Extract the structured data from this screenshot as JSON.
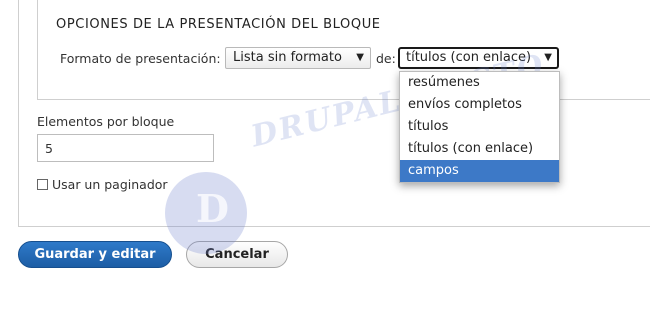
{
  "fieldset": {
    "legend": "OPCIONES DE LA PRESENTACIÓN DEL BLOQUE",
    "format_label": "Formato de presentación:",
    "format_value": "Lista sin formato",
    "de_label": "de:",
    "mode_value": "títulos (con enlace)",
    "mode_options": [
      "resúmenes",
      "envíos completos",
      "títulos",
      "títulos (con enlace)",
      "campos"
    ],
    "highlighted_option": "campos"
  },
  "items_per_block": {
    "label": "Elementos por bloque",
    "value": "5"
  },
  "pager": {
    "label": "Usar un paginador",
    "checked": false
  },
  "actions": {
    "save_label": "Guardar y editar",
    "cancel_label": "Cancelar"
  },
  "watermark": {
    "text": "DRUPALADICTO",
    "icon": "drupal-drop-logo"
  },
  "colors": {
    "primary_button": "#1c5da5",
    "highlight": "#3d79c7"
  }
}
